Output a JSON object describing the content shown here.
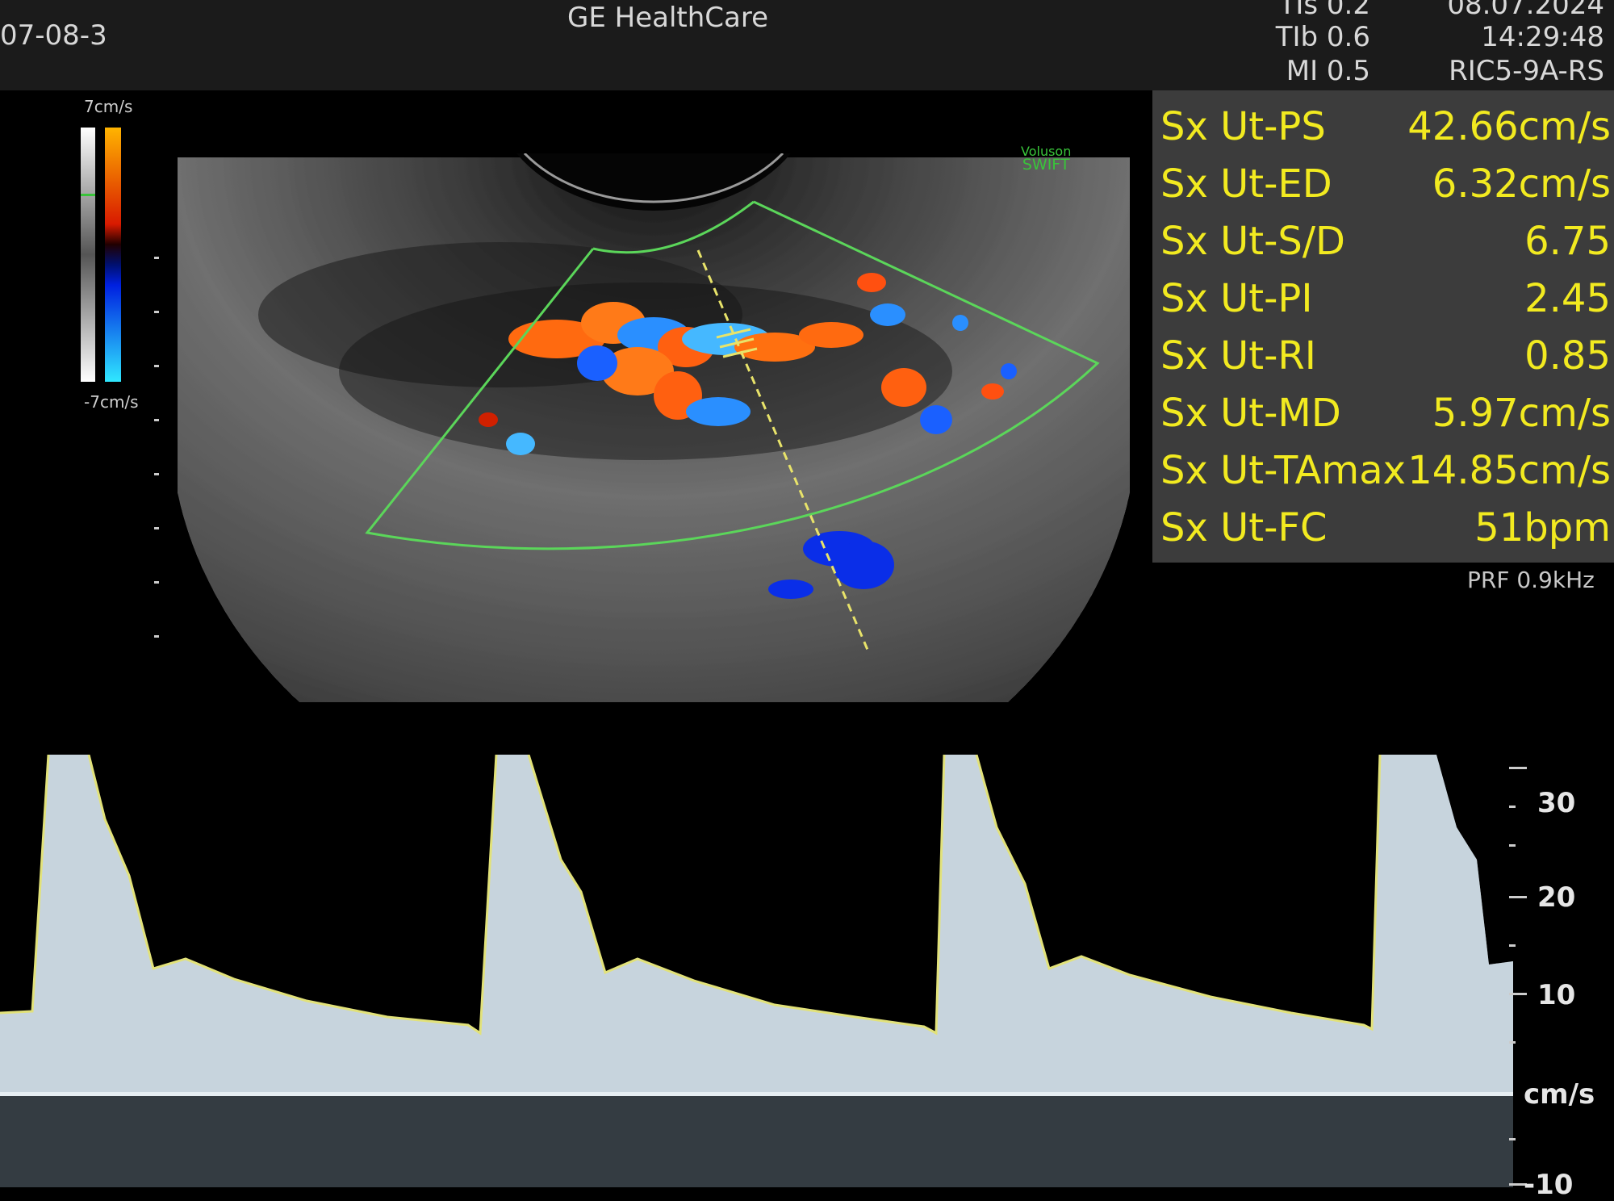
{
  "header": {
    "patient_id": "07-08-3",
    "manufacturer": "GE HealthCare",
    "tis": "TIs 0.2",
    "tib": "TIb 0.6",
    "mi": "MI 0.5",
    "date": "08.07.2024",
    "time": "14:29:48",
    "probe": "RIC5-9A-RS"
  },
  "color_scale": {
    "top": "7cm/s",
    "bottom": "-7cm/s"
  },
  "vendor_logo": {
    "line1": "Voluson",
    "line2": "SWIFT"
  },
  "measurements": [
    {
      "label": "Sx Ut-PS",
      "value": "42.66cm/s"
    },
    {
      "label": "Sx Ut-ED",
      "value": "6.32cm/s"
    },
    {
      "label": "Sx Ut-S/D",
      "value": "6.75"
    },
    {
      "label": "Sx Ut-PI",
      "value": "2.45"
    },
    {
      "label": "Sx Ut-RI",
      "value": "0.85"
    },
    {
      "label": "Sx Ut-MD",
      "value": "5.97cm/s"
    },
    {
      "label": "Sx Ut-TAmax",
      "value": "14.85cm/s"
    },
    {
      "label": "Sx Ut-FC",
      "value": "51bpm"
    }
  ],
  "prf": "PRF 0.9kHz",
  "doppler_axis": {
    "labels": [
      "30",
      "20",
      "10"
    ],
    "unit": "cm/s",
    "bottom_label": "-10"
  },
  "colors": {
    "measure_text": "#f2ea20",
    "roi_box": "#5bd65a",
    "gate_line": "#e8e36a",
    "spectrum": "#c7d4dd"
  }
}
